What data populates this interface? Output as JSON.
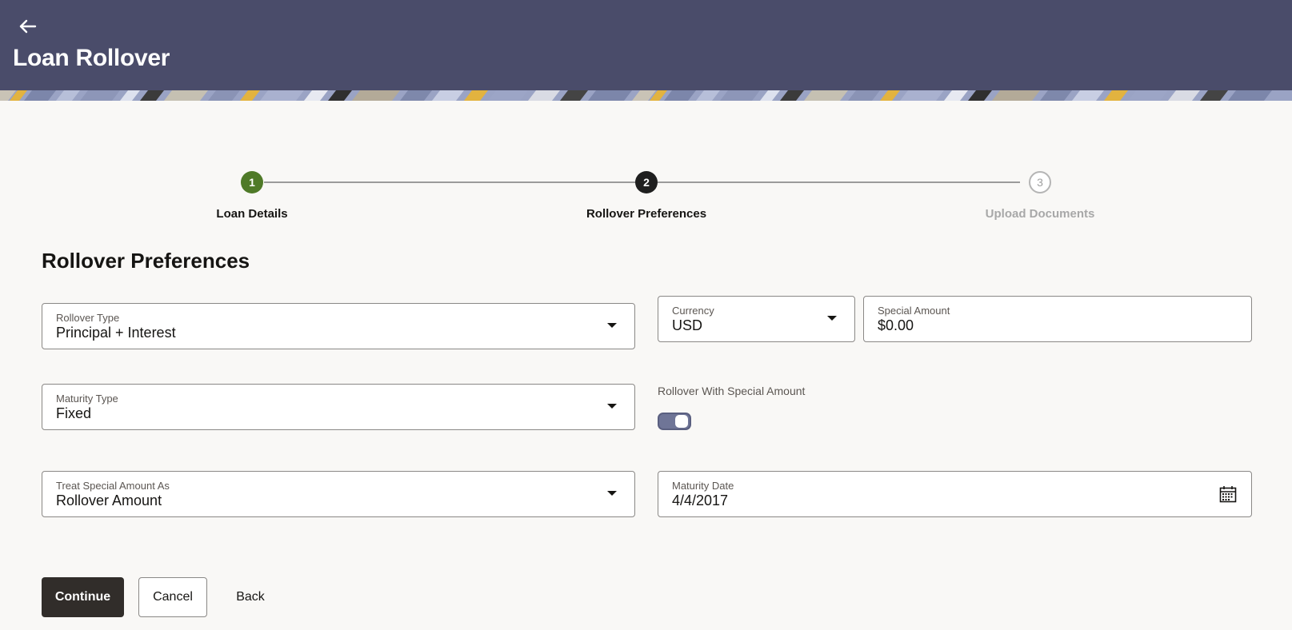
{
  "header": {
    "back_icon": "back-arrow-icon",
    "title": "Loan Rollover"
  },
  "stepper": {
    "steps": [
      {
        "number": "1",
        "label": "Loan Details",
        "state": "done"
      },
      {
        "number": "2",
        "label": "Rollover Preferences",
        "state": "active"
      },
      {
        "number": "3",
        "label": "Upload Documents",
        "state": "pending"
      }
    ]
  },
  "section": {
    "title": "Rollover Preferences"
  },
  "form": {
    "rollover_type": {
      "label": "Rollover Type",
      "value": "Principal + Interest"
    },
    "currency": {
      "label": "Currency",
      "value": "USD"
    },
    "special_amount": {
      "label": "Special Amount",
      "value": "$0.00"
    },
    "maturity_type": {
      "label": "Maturity Type",
      "value": "Fixed"
    },
    "rollover_with_special_amount": {
      "label": "Rollover With Special Amount",
      "enabled": true
    },
    "treat_special_amount_as": {
      "label": "Treat Special Amount As",
      "value": "Rollover Amount"
    },
    "maturity_date": {
      "label": "Maturity Date",
      "value": "4/4/2017",
      "icon": "calendar-icon"
    }
  },
  "actions": {
    "continue_label": "Continue",
    "cancel_label": "Cancel",
    "back_label": "Back"
  },
  "colors": {
    "header_bg": "#4a4c6a",
    "step_done": "#4f7a28",
    "step_active": "#1f1f1f",
    "primary_button": "#312d2a",
    "toggle_on": "#6f7597"
  }
}
